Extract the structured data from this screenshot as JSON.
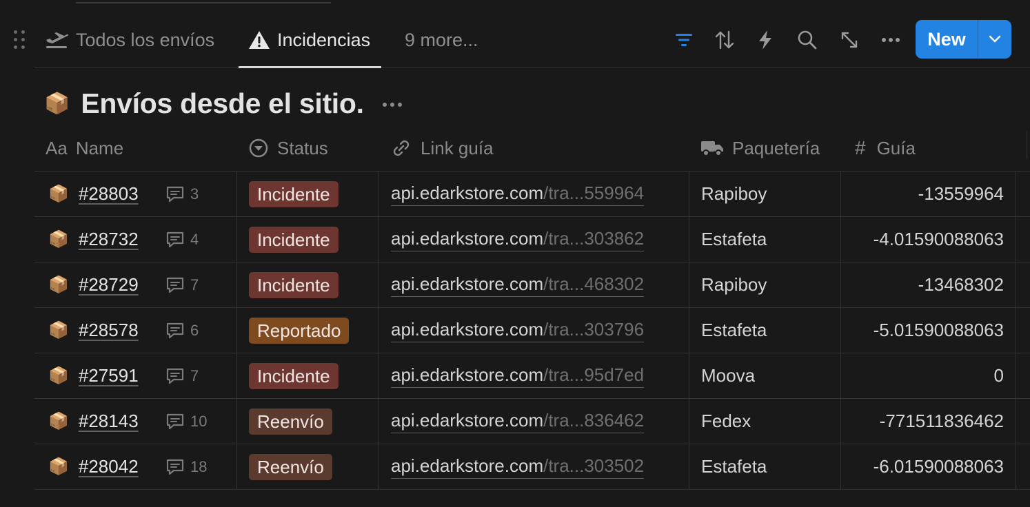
{
  "tabs": {
    "todos": "Todos los envíos",
    "incidencias": "Incidencias",
    "more": "9 more..."
  },
  "toolbar": {
    "new_label": "New",
    "accent": "#2383e2"
  },
  "database": {
    "icon": "package-icon",
    "title": "Envíos desde el sitio."
  },
  "columns": {
    "name_prefix": "Aa",
    "name": "Name",
    "status": "Status",
    "link": "Link guía",
    "paqueteria": "Paquetería",
    "guia_prefix": "#",
    "guia": "Guía"
  },
  "rows": [
    {
      "name": "#28803",
      "comments": "3",
      "status": "Incidente",
      "status_color": "#6e3630",
      "link_domain": "api.edarkstore.com",
      "link_rest": "/tra...559964",
      "paqueteria": "Rapiboy",
      "guia": "-13559964"
    },
    {
      "name": "#28732",
      "comments": "4",
      "status": "Incidente",
      "status_color": "#6e3630",
      "link_domain": "api.edarkstore.com",
      "link_rest": "/tra...303862",
      "paqueteria": "Estafeta",
      "guia": "-4.01590088063"
    },
    {
      "name": "#28729",
      "comments": "7",
      "status": "Incidente",
      "status_color": "#6e3630",
      "link_domain": "api.edarkstore.com",
      "link_rest": "/tra...468302",
      "paqueteria": "Rapiboy",
      "guia": "-13468302"
    },
    {
      "name": "#28578",
      "comments": "6",
      "status": "Reportado",
      "status_color": "#7f4a1e",
      "link_domain": "api.edarkstore.com",
      "link_rest": "/tra...303796",
      "paqueteria": "Estafeta",
      "guia": "-5.01590088063"
    },
    {
      "name": "#27591",
      "comments": "7",
      "status": "Incidente",
      "status_color": "#6e3630",
      "link_domain": "api.edarkstore.com",
      "link_rest": "/tra...95d7ed",
      "paqueteria": "Moova",
      "guia": "0"
    },
    {
      "name": "#28143",
      "comments": "10",
      "status": "Reenvío",
      "status_color": "#5c3b2f",
      "link_domain": "api.edarkstore.com",
      "link_rest": "/tra...836462",
      "paqueteria": "Fedex",
      "guia": "-771511836462"
    },
    {
      "name": "#28042",
      "comments": "18",
      "status": "Reenvío",
      "status_color": "#5c3b2f",
      "link_domain": "api.edarkstore.com",
      "link_rest": "/tra...303502",
      "paqueteria": "Estafeta",
      "guia": "-6.01590088063"
    }
  ]
}
